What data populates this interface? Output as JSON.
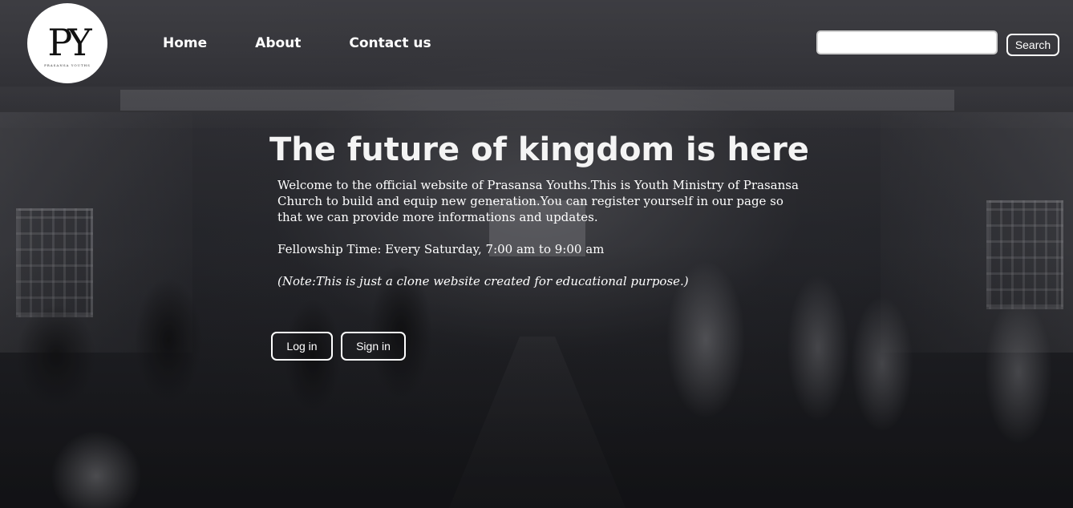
{
  "header": {
    "logo": {
      "text": "PY",
      "subtext": "PRASANSA YOUTHS"
    },
    "nav": [
      {
        "label": "Home"
      },
      {
        "label": "About"
      },
      {
        "label": "Contact us"
      }
    ],
    "search": {
      "value": "",
      "placeholder": "",
      "button_label": "Search"
    }
  },
  "hero": {
    "title": "The future of kingdom is here",
    "welcome_text": "Welcome to the official website of Prasansa Youths.This is Youth Ministry of Prasansa Church to build and equip new generation.You can register yourself in our page so that we can provide more informations and updates.",
    "fellowship_text": "Fellowship Time:  Every Saturday, 7:00 am to 9:00 am",
    "note_text": "(Note:This is just a clone website created for educational purpose.)",
    "buttons": {
      "login": "Log in",
      "signin": "Sign in"
    }
  },
  "colors": {
    "text": "#ffffff",
    "button_border": "#ffffff",
    "overlay": "#1e1f24"
  }
}
